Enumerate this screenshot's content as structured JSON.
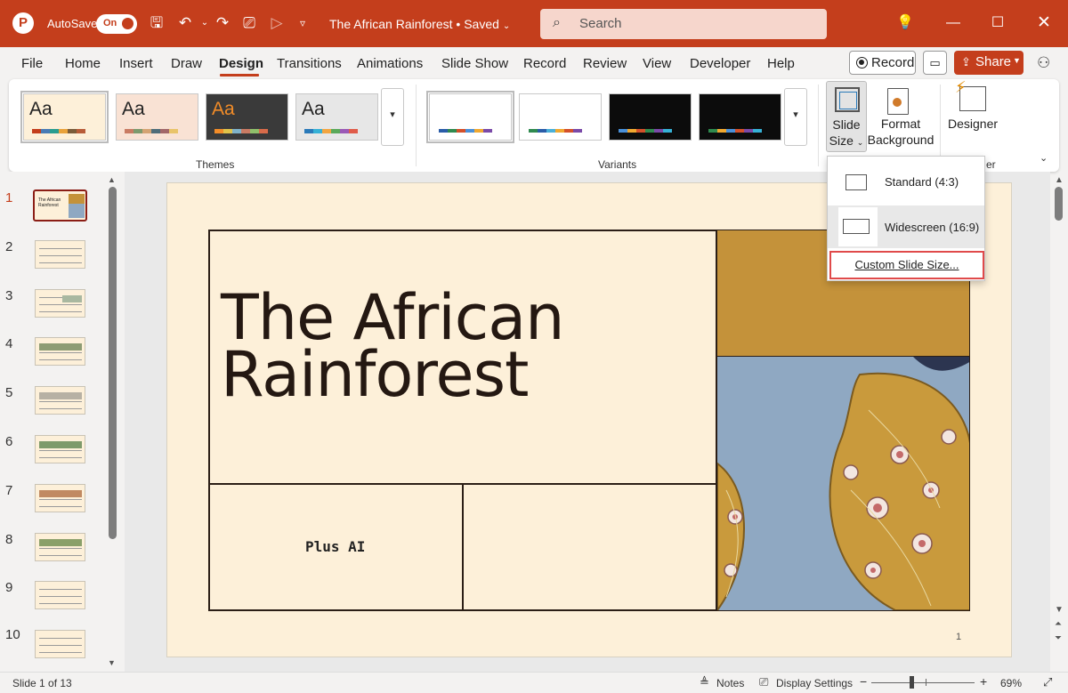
{
  "app": {
    "autosave_label": "AutoSave",
    "autosave_state": "On",
    "doc_title": "The African Rainforest • Saved",
    "search_placeholder": "Search"
  },
  "menu": {
    "tabs": [
      "File",
      "Home",
      "Insert",
      "Draw",
      "Design",
      "Transitions",
      "Animations",
      "Slide Show",
      "Record",
      "Review",
      "View",
      "Developer",
      "Help"
    ],
    "active_tab": "Design",
    "record_label": "Record",
    "share_label": "Share"
  },
  "ribbon": {
    "themes_label": "Themes",
    "variants_label": "Variants",
    "themes": [
      {
        "sample": "Aa",
        "bg": "#fdf0d9",
        "fg": "#222222",
        "bars": [
          "#c43e1c",
          "#4a7bb5",
          "#2a9d8f",
          "#e9a23b",
          "#7a5c3a",
          "#b85c38"
        ]
      },
      {
        "sample": "Aa",
        "bg": "#f9e2d4",
        "fg": "#222222",
        "bars": [
          "#c97b63",
          "#7d9a6e",
          "#d4a373",
          "#4f6d7a",
          "#a26769",
          "#e9c46a"
        ]
      },
      {
        "sample": "Aa",
        "bg": "#3a3a3a",
        "fg": "#f28c28",
        "bars": [
          "#f28c28",
          "#e0c34a",
          "#7fb2c9",
          "#c97b63",
          "#8fbf6b",
          "#d86b4a"
        ]
      },
      {
        "sample": "Aa",
        "bg": "#e7e7e7",
        "fg": "#222222",
        "bars": [
          "#2a7ab9",
          "#36b1d6",
          "#f2a541",
          "#5aa95a",
          "#9b59b6",
          "#e05c4a"
        ]
      }
    ],
    "variants": [
      {
        "bg": "#ffffff",
        "bars": [
          "#2a5ca8",
          "#2f8a4f",
          "#d4502a",
          "#4a90d9",
          "#f0a830",
          "#7a4aa8"
        ]
      },
      {
        "bg": "#ffffff",
        "bars": [
          "#2f8a4f",
          "#2a5ca8",
          "#4ab0d9",
          "#f0a830",
          "#d4502a",
          "#7a4aa8"
        ]
      },
      {
        "bg": "#0c0c0c",
        "bars": [
          "#4a90d9",
          "#f0a830",
          "#d4502a",
          "#2f8a4f",
          "#7a4aa8",
          "#36b1d6"
        ]
      },
      {
        "bg": "#0c0c0c",
        "bars": [
          "#2f8a4f",
          "#f0a830",
          "#4a90d9",
          "#d4502a",
          "#7a4aa8",
          "#36b1d6"
        ]
      }
    ],
    "slide_size_line1": "Slide",
    "slide_size_line2": "Size",
    "format_bg_line1": "Format",
    "format_bg_line2": "Background",
    "designer_label": "Designer",
    "designer_group_fragment": "er"
  },
  "dropdown": {
    "standard": "Standard (4:3)",
    "widescreen": "Widescreen (16:9)",
    "custom": "Custom Slide Size..."
  },
  "slides_panel": {
    "numbers": [
      "1",
      "2",
      "3",
      "4",
      "5",
      "6",
      "7",
      "8",
      "9",
      "10"
    ],
    "active": "1",
    "thumb1_text": "The African Rainforest"
  },
  "slide": {
    "title_line1": "The African",
    "title_line2": "Rainforest",
    "subtitle": "Plus AI",
    "page_number": "1"
  },
  "status": {
    "slide_info": "Slide 1 of 13",
    "notes": "Notes",
    "display_settings": "Display Settings",
    "zoom": "69%",
    "zoom_level": 0.69
  },
  "colors": {
    "accent": "#c43e1c",
    "slide_bg": "#fdf0d9",
    "gold": "#c4923a"
  }
}
